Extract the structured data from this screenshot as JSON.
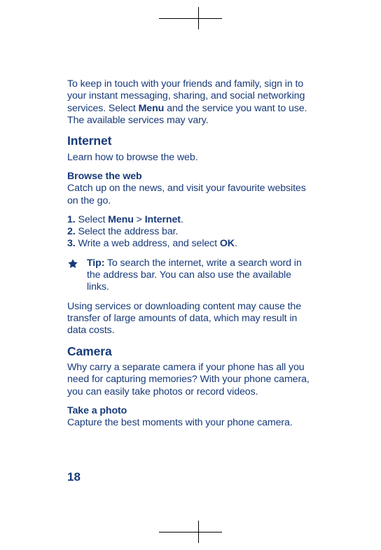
{
  "para1_pre": "To keep in touch with your friends and family, sign in to your instant messaging, sharing, and social networking services. Select ",
  "para1_bold1": "Menu",
  "para1_post": " and the service you want to use. The available services may vary.",
  "section_internet": "Internet",
  "internet_intro": "Learn how to browse the web.",
  "browse_heading": "Browse the web",
  "browse_intro": "Catch up on the news, and visit your favourite websites on the go.",
  "steps": {
    "s1_num": "1.",
    "s1_a": " Select ",
    "s1_bold1": "Menu",
    "s1_gt": " > ",
    "s1_bold2": "Internet",
    "s1_end": ".",
    "s2_num": "2.",
    "s2_text": " Select the address bar.",
    "s3_num": "3.",
    "s3_a": " Write a web address, and select ",
    "s3_bold": "OK",
    "s3_end": "."
  },
  "tip_label": "Tip:",
  "tip_text": " To search the internet, write a search word in the address bar. You can also use the available links.",
  "internet_warn": "Using services or downloading content may cause the transfer of large amounts of data, which may result in data costs.",
  "section_camera": "Camera",
  "camera_intro": "Why carry a separate camera if your phone has all you need for capturing memories? With your phone camera, you can easily take photos or record videos.",
  "takephoto_heading": "Take a photo",
  "takephoto_intro": "Capture the best moments with your phone camera.",
  "page_number": "18",
  "icons": {
    "tip_star": "star-icon"
  }
}
